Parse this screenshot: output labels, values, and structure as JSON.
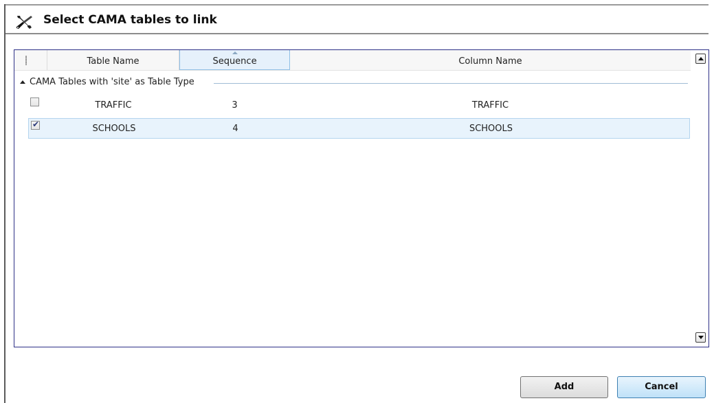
{
  "dialog": {
    "title": "Select CAMA tables to link",
    "title_icon": "tools-icon"
  },
  "grid": {
    "columns": [
      "Table Name",
      "Sequence",
      "Column Name"
    ],
    "sorted_column": "Sequence",
    "group": {
      "label": "CAMA Tables with 'site' as Table Type",
      "expanded": true
    },
    "rows": [
      {
        "checked": false,
        "table_name": "TRAFFIC",
        "sequence": "3",
        "column_name": "TRAFFIC",
        "selected": false
      },
      {
        "checked": true,
        "table_name": "SCHOOLS",
        "sequence": "4",
        "column_name": "SCHOOLS",
        "selected": true
      }
    ]
  },
  "buttons": {
    "add_label": "Add",
    "cancel_label": "Cancel"
  },
  "colors": {
    "grid_border": "#2c2f86",
    "selected_row": "#e8f3fc",
    "cancel_button": "#bfe1f8"
  }
}
